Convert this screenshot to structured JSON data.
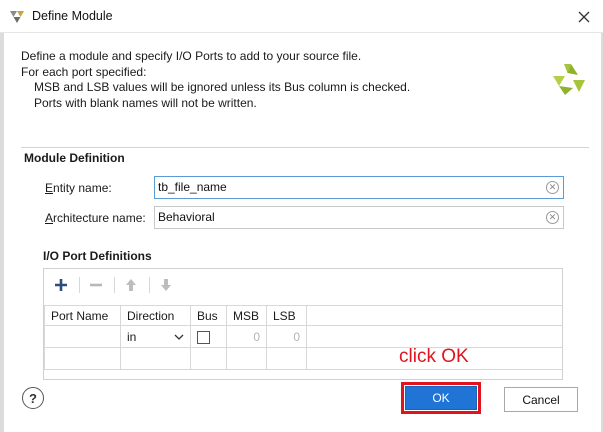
{
  "window": {
    "title": "Define Module",
    "app_icon": "vivado-icon",
    "close_icon": "close-icon"
  },
  "description": {
    "line1": "Define a module and specify I/O Ports to add to your source file.",
    "line2": "For each port specified:",
    "line3": "MSB and LSB values will be ignored unless its Bus column is checked.",
    "line4": "Ports with blank names will not be written."
  },
  "module_definition": {
    "title": "Module Definition",
    "entity_label_prefix": "",
    "entity_label_u": "E",
    "entity_label_rest": "ntity name:",
    "entity_value": "tb_file_name",
    "arch_label_u": "A",
    "arch_label_rest": "rchitecture name:",
    "arch_value": "Behavioral"
  },
  "io_ports": {
    "title": "I/O Port Definitions",
    "toolbar": [
      "add-icon",
      "remove-icon",
      "move-up-icon",
      "move-down-icon"
    ],
    "columns": [
      "Port Name",
      "Direction",
      "Bus",
      "MSB",
      "LSB"
    ],
    "rows": [
      {
        "port_name": "",
        "direction": "in",
        "bus": false,
        "msb": "0",
        "lsb": "0"
      }
    ]
  },
  "annotation": "click OK",
  "buttons": {
    "help": "?",
    "ok": "OK",
    "cancel": "Cancel"
  },
  "colors": {
    "accent": "#1f74d6",
    "annotation": "#e0141e",
    "logo": "#a7c43a"
  }
}
